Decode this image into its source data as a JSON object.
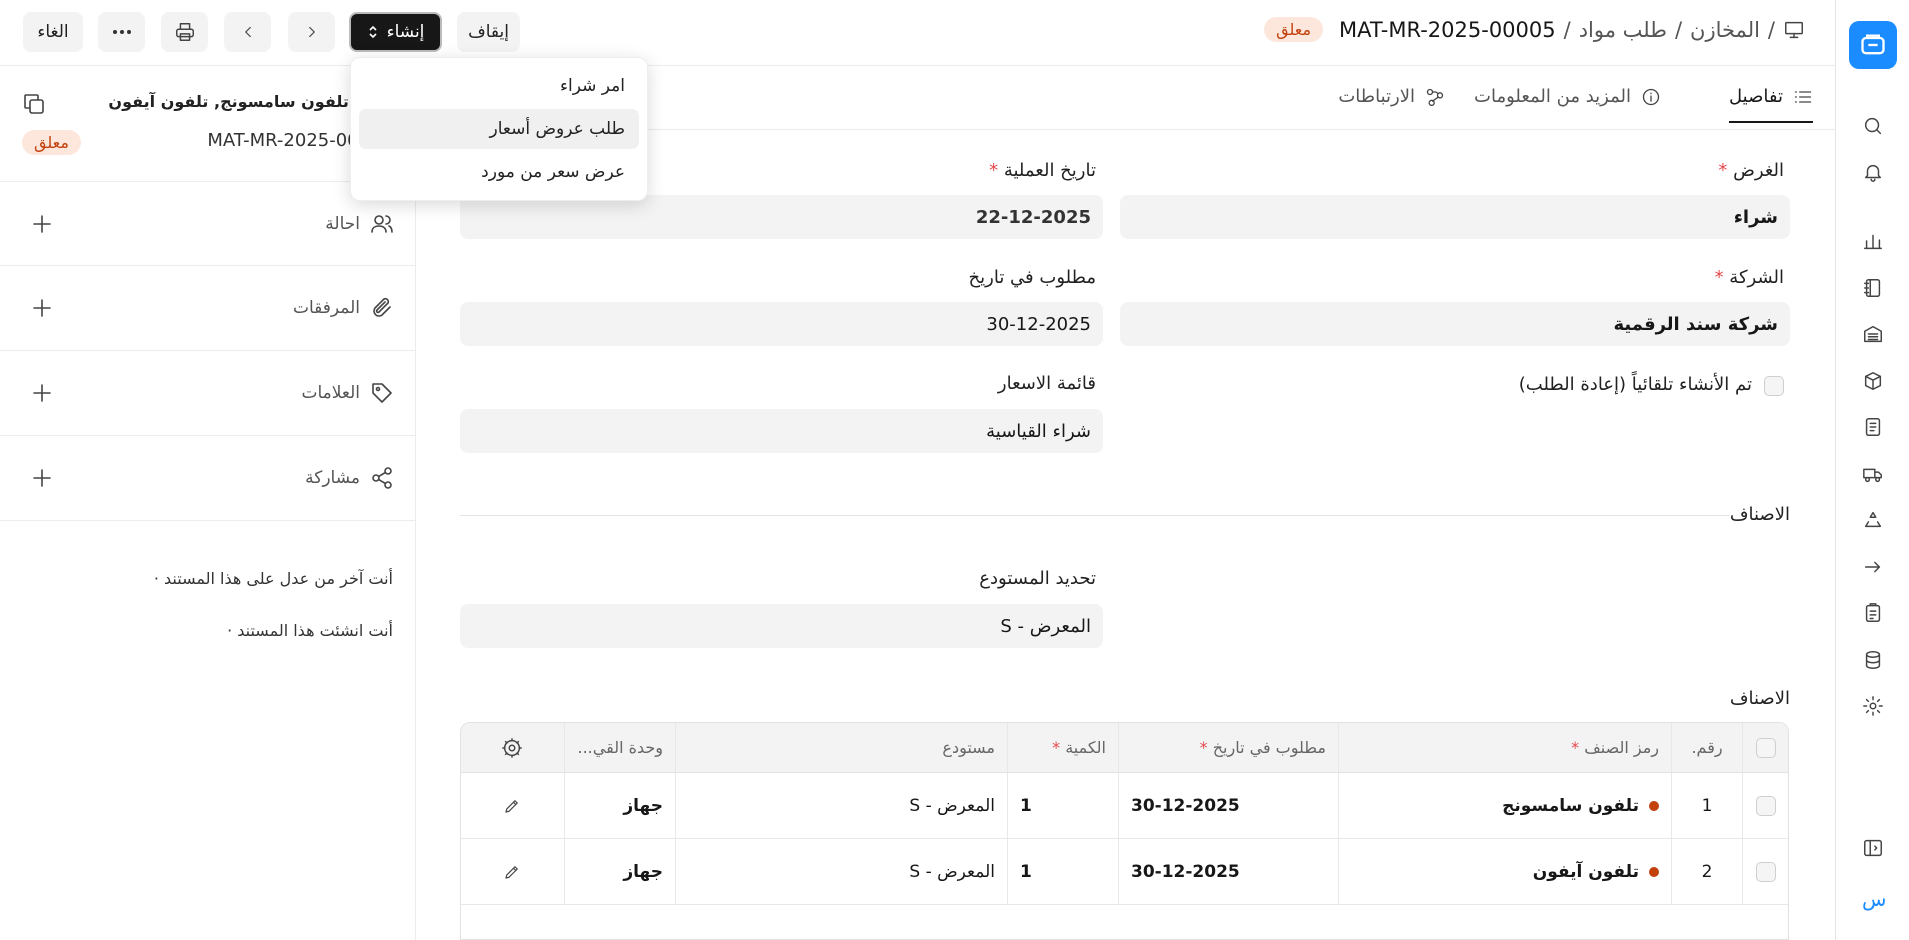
{
  "breadcrumb": {
    "root": "المخازن",
    "doctype": "طلب مواد",
    "current": "MAT-MR-2025-00005",
    "status": "معلق"
  },
  "toolbar": {
    "stop": "إيقاف",
    "create": "إنشاء",
    "cancel": "الغاء"
  },
  "create_menu": [
    "امر شراء",
    "طلب عروض أسعار",
    "عرض سعر من مورد"
  ],
  "sidebar": {
    "title": "طلب تلفون سامسونج, تلفون آيفون",
    "doc_id": "MAT-MR-2025-00005",
    "status": "معلق",
    "rows": [
      "احالة",
      "المرفقات",
      "العلامات",
      "مشاركة"
    ],
    "activity": [
      "أنت آخر من عدل على هذا المستند ·",
      "أنت انشئت هذا المستند ·"
    ]
  },
  "tabs": [
    "تفاصيل",
    "المزيد من المعلومات",
    "الارتباطات"
  ],
  "form": {
    "purpose_label": "الغرض",
    "purpose": "شراء",
    "company_label": "الشركة",
    "company": "شركة سند الرقمية",
    "auto_label": "تم الأنشاء تلقائياً (إعادة الطلب)",
    "date_label": "تاريخ العملية",
    "date": "22-12-2025",
    "req_by_label": "مطلوب في تاريخ",
    "req_by": "30-12-2025",
    "price_list_label": "قائمة الاسعار",
    "price_list": "شراء القياسية",
    "section_items": "الاصناف",
    "warehouse_label": "تحديد المستودع",
    "warehouse": "المعرض - S",
    "items_label": "الاصناف"
  },
  "table": {
    "headers": [
      "رقم.",
      "رمز الصنف",
      "مطلوب في تاريخ",
      "الكمية",
      "مستودع",
      "وحدة القي..."
    ],
    "rows": [
      {
        "no": "1",
        "item": "تلفون سامسونج",
        "date": "30-12-2025",
        "qty": "1",
        "wh": "المعرض - S",
        "uom": "جهاز"
      },
      {
        "no": "2",
        "item": "تلفون آيفون",
        "date": "30-12-2025",
        "qty": "1",
        "wh": "المعرض - S",
        "uom": "جهاز"
      }
    ]
  },
  "rail": {
    "user_initial": "س"
  },
  "colors": {
    "accent": "#1a8cff",
    "status_bg": "#fde7dc",
    "status_fg": "#c2410c",
    "dot": "#c2410c"
  }
}
